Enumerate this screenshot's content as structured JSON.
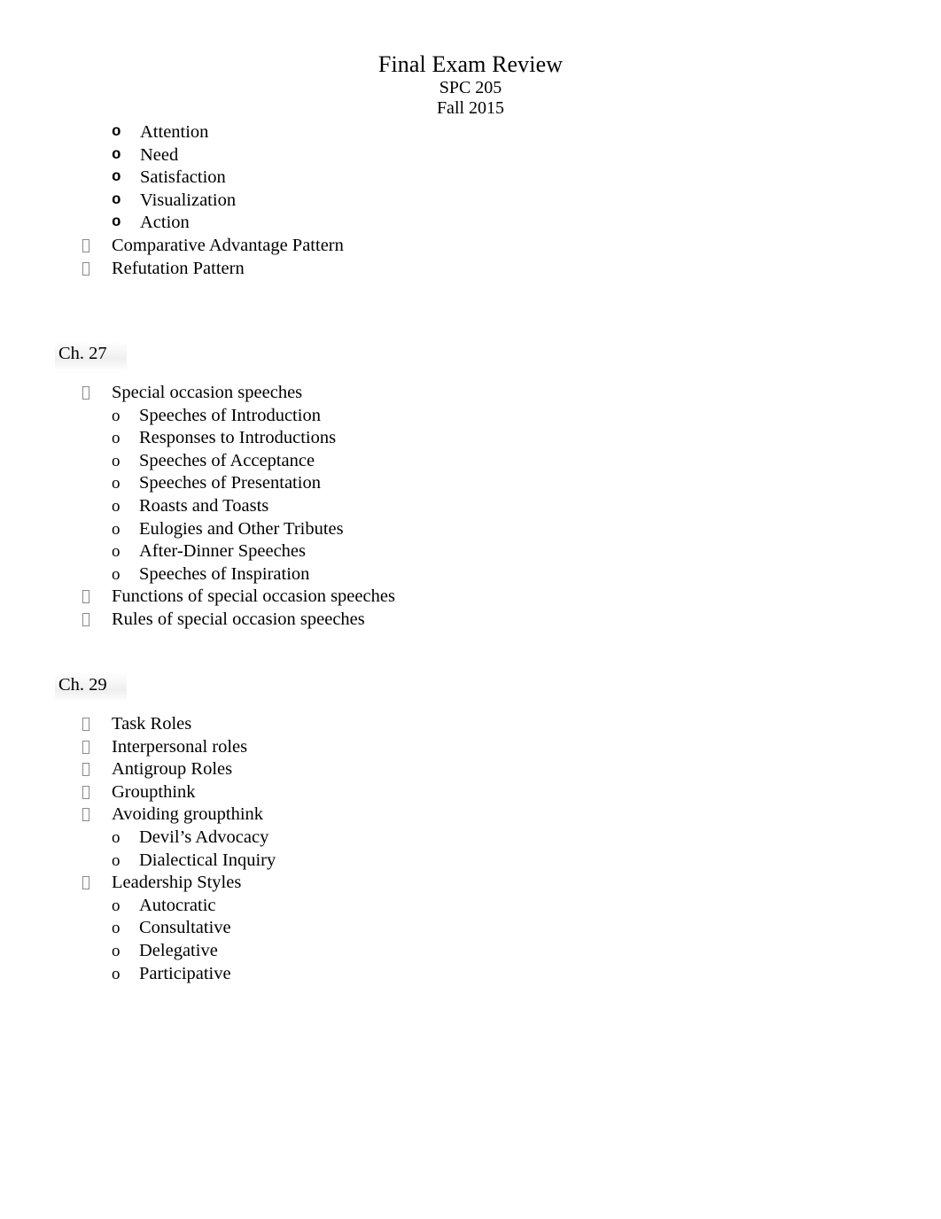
{
  "document": {
    "title": "Final Exam Review",
    "course": "SPC 205",
    "term": "Fall 2015"
  },
  "bullet_glyphs": {
    "level1": "tofu-box",
    "level2_bold": "o",
    "level2_plain": "o"
  },
  "sections": [
    {
      "heading": null,
      "items": [
        {
          "level": 2,
          "marker_style": "bold-o",
          "label": "Attention"
        },
        {
          "level": 2,
          "marker_style": "bold-o",
          "label": "Need"
        },
        {
          "level": 2,
          "marker_style": "bold-o",
          "label": "Satisfaction"
        },
        {
          "level": 2,
          "marker_style": "bold-o",
          "label": "Visualization"
        },
        {
          "level": 2,
          "marker_style": "bold-o",
          "label": "Action"
        },
        {
          "level": 1,
          "marker_style": "tofu",
          "label": "Comparative Advantage Pattern"
        },
        {
          "level": 1,
          "marker_style": "tofu",
          "label": "Refutation Pattern"
        }
      ]
    },
    {
      "heading": "Ch. 27",
      "items": [
        {
          "level": 1,
          "marker_style": "tofu",
          "label": "Special occasion speeches"
        },
        {
          "level": 2,
          "marker_style": "plain-o",
          "label": "Speeches of Introduction"
        },
        {
          "level": 2,
          "marker_style": "plain-o",
          "label": "Responses to Introductions"
        },
        {
          "level": 2,
          "marker_style": "plain-o",
          "label": "Speeches of Acceptance"
        },
        {
          "level": 2,
          "marker_style": "plain-o",
          "label": "Speeches of Presentation"
        },
        {
          "level": 2,
          "marker_style": "plain-o",
          "label": "Roasts and Toasts"
        },
        {
          "level": 2,
          "marker_style": "plain-o",
          "label": "Eulogies and Other Tributes"
        },
        {
          "level": 2,
          "marker_style": "plain-o",
          "label": "After-Dinner Speeches"
        },
        {
          "level": 2,
          "marker_style": "plain-o",
          "label": "Speeches of Inspiration"
        },
        {
          "level": 1,
          "marker_style": "tofu",
          "label": "Functions of special occasion speeches"
        },
        {
          "level": 1,
          "marker_style": "tofu",
          "label": "Rules of special occasion speeches"
        }
      ]
    },
    {
      "heading": "Ch. 29",
      "items": [
        {
          "level": 1,
          "marker_style": "tofu",
          "label": "Task Roles"
        },
        {
          "level": 1,
          "marker_style": "tofu",
          "label": "Interpersonal roles"
        },
        {
          "level": 1,
          "marker_style": "tofu",
          "label": "Antigroup Roles"
        },
        {
          "level": 1,
          "marker_style": "tofu",
          "label": "Groupthink"
        },
        {
          "level": 1,
          "marker_style": "tofu",
          "label": "Avoiding groupthink"
        },
        {
          "level": 2,
          "marker_style": "plain-o",
          "label": "Devil’s Advocacy"
        },
        {
          "level": 2,
          "marker_style": "plain-o",
          "label": "Dialectical Inquiry"
        },
        {
          "level": 1,
          "marker_style": "tofu",
          "label": "Leadership Styles"
        },
        {
          "level": 2,
          "marker_style": "plain-o",
          "label": "Autocratic"
        },
        {
          "level": 2,
          "marker_style": "plain-o",
          "label": "Consultative"
        },
        {
          "level": 2,
          "marker_style": "plain-o",
          "label": "Delegative"
        },
        {
          "level": 2,
          "marker_style": "plain-o",
          "label": "Participative"
        }
      ]
    }
  ]
}
